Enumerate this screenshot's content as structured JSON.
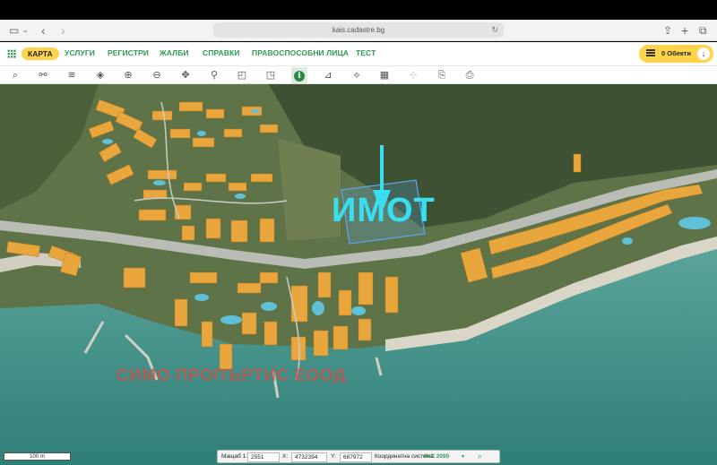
{
  "browser": {
    "url": "kais.cadastre.bg",
    "sidebar_icon": "sidebar-icon",
    "reload_icon": "↻"
  },
  "nav": {
    "active": "КАРТА",
    "items": [
      "УСЛУГИ",
      "РЕГИСТРИ",
      "ЖАЛБИ",
      "СПРАВКИ",
      "ПРАВОСПОСОБНИ ЛИЦА",
      "ТЕСТ"
    ],
    "objects_label": "0 Обекти",
    "objects_arrow": "↓"
  },
  "toolbar": {
    "tools": [
      {
        "icon": "search-icon",
        "glyph": "⌕"
      },
      {
        "icon": "network-icon",
        "glyph": "⚯"
      },
      {
        "icon": "layers-icon",
        "glyph": "≋"
      },
      {
        "icon": "stack-icon",
        "glyph": "◈"
      },
      {
        "icon": "zoom-in-icon",
        "glyph": "⊕"
      },
      {
        "icon": "zoom-out-icon",
        "glyph": "⊖"
      },
      {
        "icon": "pan-icon",
        "glyph": "✥"
      },
      {
        "icon": "location-pin-icon",
        "glyph": "⚲"
      },
      {
        "icon": "select-rectangle-icon",
        "glyph": "◰"
      },
      {
        "icon": "select-area-icon",
        "glyph": "◳"
      },
      {
        "icon": "info-icon",
        "glyph": "i"
      },
      {
        "icon": "measure-distance-icon",
        "glyph": "⊿"
      },
      {
        "icon": "measure-area-icon",
        "glyph": "⟡"
      },
      {
        "icon": "map-icon",
        "glyph": "▦"
      },
      {
        "icon": "crosshair-icon",
        "glyph": "⊹"
      },
      {
        "icon": "export-icon",
        "glyph": "⎘"
      },
      {
        "icon": "print-icon",
        "glyph": "⎙"
      }
    ]
  },
  "map": {
    "annotation": "ИМОТ",
    "watermark": "СИМО ПРОПЪРТИС ЕООД",
    "scale": "100 m",
    "colors": {
      "building": "#e8a63c",
      "road": "#b9bdb6",
      "sea": "#3f8f86",
      "parcel": "#5aa8ee",
      "annotation": "#39dff0"
    }
  },
  "coords": {
    "scale_label": "Мащаб 1:",
    "scale_value": "2551",
    "x_label": "X:",
    "x_value": "4732394",
    "y_label": "Y:",
    "y_value": "687972",
    "system_label": "Координатна система:",
    "system_value": "КкС 2005",
    "dropdown_icon": "▾",
    "search_icon": "⌕"
  }
}
